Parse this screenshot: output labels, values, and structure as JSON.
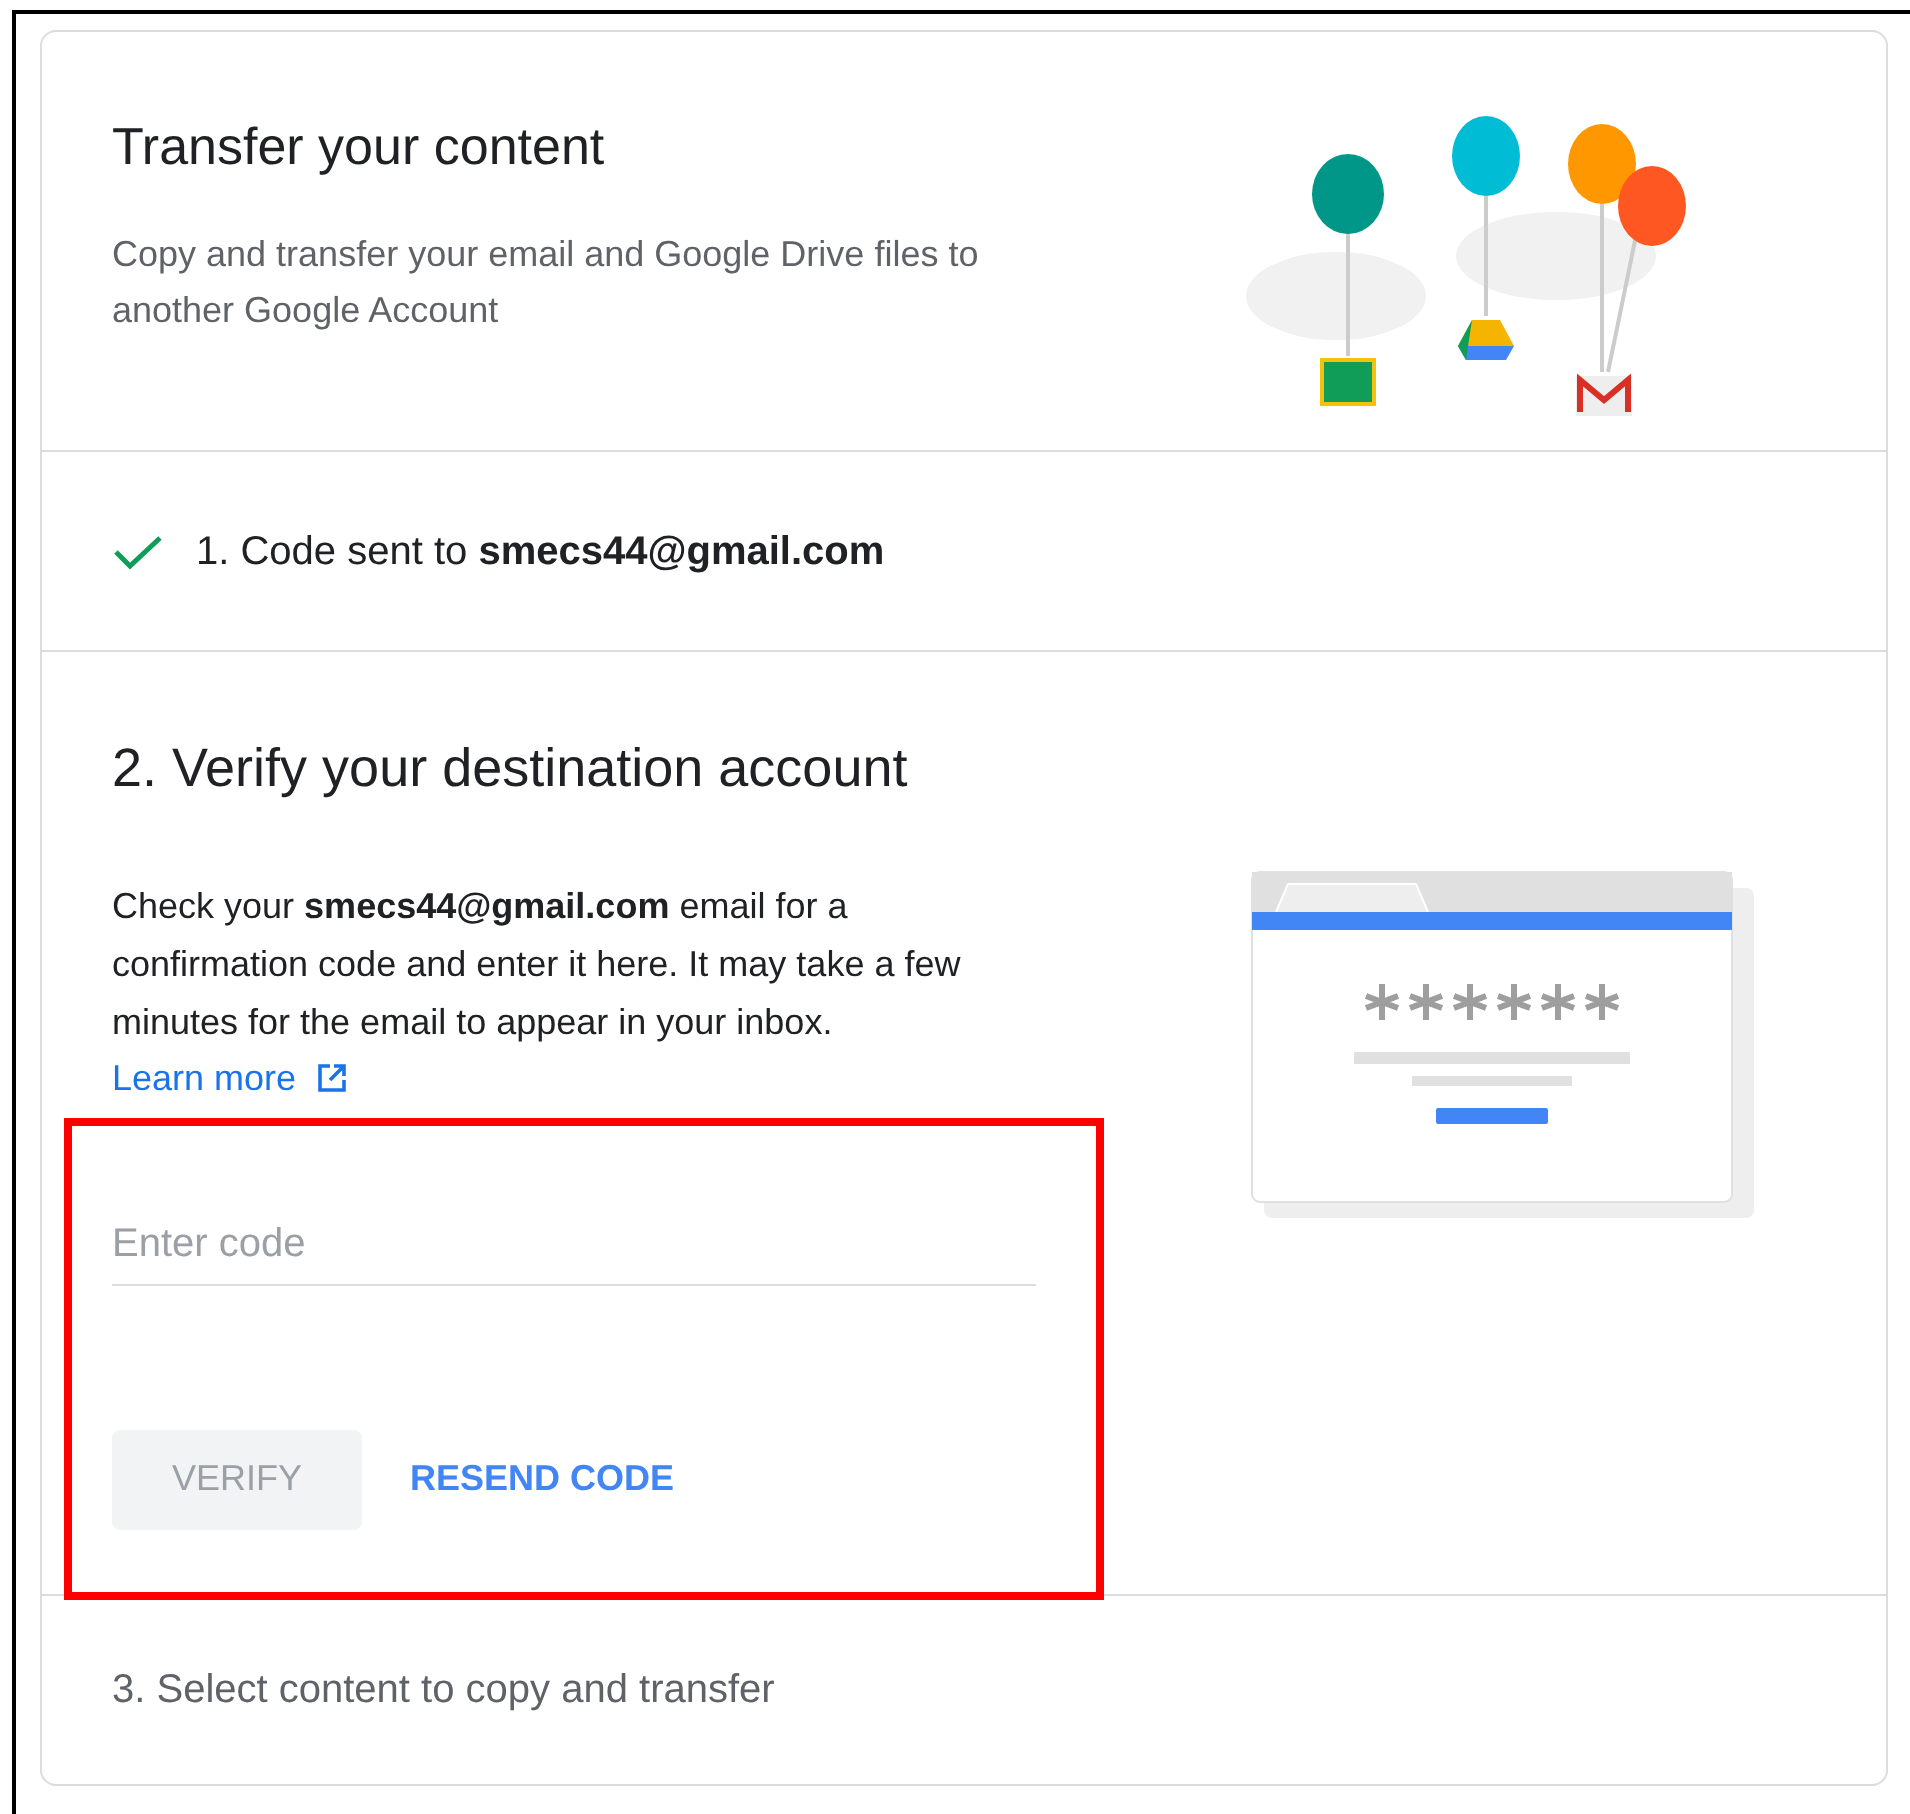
{
  "header": {
    "title": "Transfer your content",
    "description": "Copy and transfer your email and Google Drive files to another Google Account"
  },
  "steps": [
    {
      "kind": "done",
      "text": "1. Code sent to **smecs44@gmail.com**"
    },
    {
      "kind": "active",
      "title": "2. Verify your destination account",
      "body": "Check your **smecs44@gmail.com** email for a confirmation code and enter it here. It may take a few minutes for the email to appear in your inbox.",
      "link": "Learn more",
      "field": {
        "placeholder": "Enter code"
      },
      "buttons": [
        {
          "label": "VERIFY",
          "disabled": true
        },
        {
          "label": "RESEND CODE",
          "disabled": false
        }
      ],
      "highlighted": true
    },
    {
      "kind": "pending",
      "text": "3. Select content to copy and transfer"
    }
  ]
}
